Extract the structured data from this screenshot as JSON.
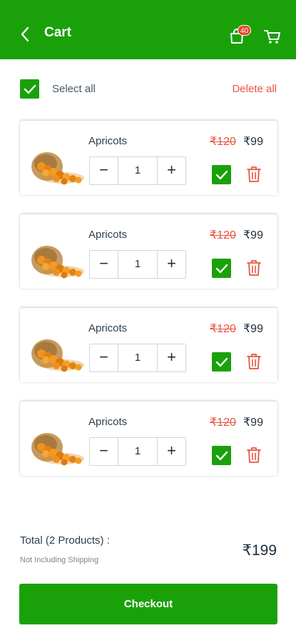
{
  "header": {
    "title": "Cart",
    "back_icon": "chevron-left-icon",
    "bag_icon": "shopping-bag-icon",
    "bag_badge": "40",
    "cart_icon": "cart-icon",
    "color": "#1aa10a"
  },
  "select_all": {
    "label": "Select all",
    "checked": true,
    "delete_label": "Delete all"
  },
  "items": [
    {
      "name": "Apricots",
      "old_price": "₹120",
      "price": "₹99",
      "quantity": "1",
      "checked": true
    },
    {
      "name": "Apricots",
      "old_price": "₹120",
      "price": "₹99",
      "quantity": "1",
      "checked": true
    },
    {
      "name": "Apricots",
      "old_price": "₹120",
      "price": "₹99",
      "quantity": "1",
      "checked": true
    },
    {
      "name": "Apricots",
      "old_price": "₹120",
      "price": "₹99",
      "quantity": "1",
      "checked": true
    }
  ],
  "stepper": {
    "minus": "−",
    "plus": "+"
  },
  "summary": {
    "total_label": "Total (2 Products) :",
    "note": "Not Including Shipping",
    "amount": "₹199"
  },
  "checkout": {
    "label": "Checkout"
  },
  "colors": {
    "accent": "#1aa10a",
    "danger": "#e8553f",
    "text": "#1d2f3f"
  }
}
